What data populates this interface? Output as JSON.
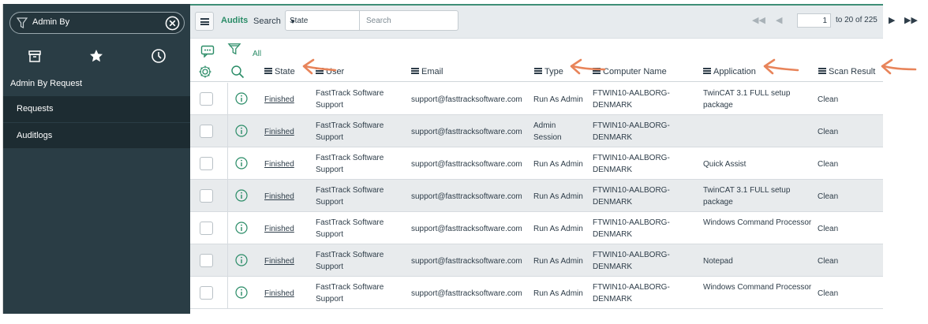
{
  "sidebar": {
    "filter_value": "Admin By",
    "tabs": [
      {
        "name": "all-applications",
        "icon": "archive-icon"
      },
      {
        "name": "favorites",
        "icon": "star-icon"
      },
      {
        "name": "history",
        "icon": "clock-icon"
      }
    ],
    "app_title": "Admin By Request",
    "modules": [
      "Requests",
      "Auditlogs"
    ]
  },
  "header": {
    "list_title": "Audits",
    "search_label": "Search",
    "search_field_selected": "State",
    "search_placeholder": "Search",
    "current_page": "1",
    "page_range_text": "to 20 of 225"
  },
  "subbar": {
    "breadcrumb_all": "All"
  },
  "table": {
    "columns": [
      "State",
      "User",
      "Email",
      "Type",
      "Computer Name",
      "Application",
      "Scan Result"
    ],
    "rows": [
      {
        "state": "Finished",
        "user": "FastTrack Software Support",
        "email": "support@fasttracksoftware.com",
        "type": "Run As Admin",
        "computer": "FTWIN10-AALBORG-DENMARK",
        "application": "TwinCAT 3.1 FULL setup package",
        "scan": "Clean"
      },
      {
        "state": "Finished",
        "user": "FastTrack Software Support",
        "email": "support@fasttracksoftware.com",
        "type": "Admin Session",
        "computer": "FTWIN10-AALBORG-DENMARK",
        "application": "",
        "scan": "Clean"
      },
      {
        "state": "Finished",
        "user": "FastTrack Software Support",
        "email": "support@fasttracksoftware.com",
        "type": "Run As Admin",
        "computer": "FTWIN10-AALBORG-DENMARK",
        "application": "Quick Assist",
        "scan": "Clean"
      },
      {
        "state": "Finished",
        "user": "FastTrack Software Support",
        "email": "support@fasttracksoftware.com",
        "type": "Run As Admin",
        "computer": "FTWIN10-AALBORG-DENMARK",
        "application": "TwinCAT 3.1 FULL setup package",
        "scan": "Clean"
      },
      {
        "state": "Finished",
        "user": "FastTrack Software Support",
        "email": "support@fasttracksoftware.com",
        "type": "Run As Admin",
        "computer": "FTWIN10-AALBORG-DENMARK",
        "application": "Windows Command Processor",
        "scan": "Clean"
      },
      {
        "state": "Finished",
        "user": "FastTrack Software Support",
        "email": "support@fasttracksoftware.com",
        "type": "Run As Admin",
        "computer": "FTWIN10-AALBORG-DENMARK",
        "application": "Notepad",
        "scan": "Clean"
      },
      {
        "state": "Finished",
        "user": "FastTrack Software Support",
        "email": "support@fasttracksoftware.com",
        "type": "Run As Admin",
        "computer": "FTWIN10-AALBORG-DENMARK",
        "application": "Windows Command Processor",
        "scan": "Clean"
      }
    ]
  },
  "colors": {
    "sidebar_bg": "#2a3d45",
    "module_bg": "#1d2c32",
    "accent_green": "#2a8c67",
    "annotation_arrow": "#e8845a"
  }
}
